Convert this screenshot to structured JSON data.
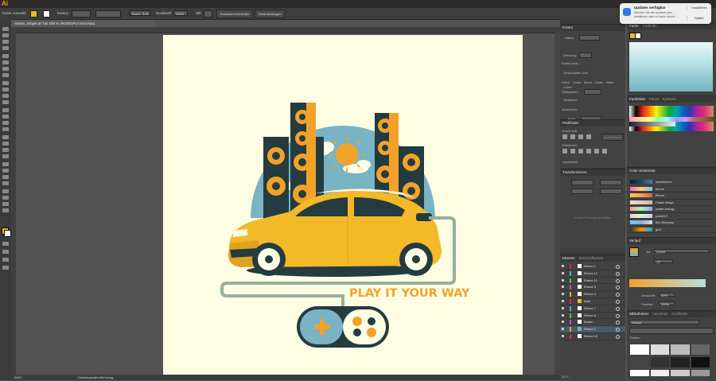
{
  "menubar": {
    "app_logo": "Ai"
  },
  "control_bar": {
    "selection_label": "Keine Auswahl",
    "stroke_label": "Kontur:",
    "stroke_profile": "Rund · 3 Pt.",
    "opacity_label": "Deckkraft:",
    "opacity_value": "100%",
    "style_label": "Stil:",
    "doc_setup_button": "Dokument einrichten",
    "prefs_button": "Voreinstellungen"
  },
  "document": {
    "tab_title": "nissan_simple.ai* bei 150 % (RGB/GPU-Vorschau)",
    "zoom": "150%",
    "status_tool": "Direktauswahl-Werkzeug"
  },
  "artwork": {
    "headline": "PLAY IT YOUR WAY"
  },
  "notification": {
    "title": "Updates verfügbar",
    "body_line1": "Möchten Sie die Updates jetzt",
    "body_line2": "installieren oder es heute Abend ...",
    "install_button": "Installieren",
    "later_button": "Später"
  },
  "panels": {
    "kontur": {
      "title": "Kontur",
      "starke": "Stärke:",
      "gehrung": "Gehrung:",
      "ausrichten": "Kontur ausr.:",
      "dashed": "Gestrichelte Linie",
      "dash_cols": [
        "Strich",
        "Lücke",
        "Strich",
        "Lücke",
        "Strich",
        "Lücke"
      ],
      "pfeilspitzen": "Pfeilspitzen:",
      "skalieren": "Skalieren:",
      "ausrichten2": "Ausrichten:",
      "profil": "Profil:"
    },
    "farbe": {
      "title": "Farbe",
      "tab2": "Farbhilfe"
    },
    "farbfelder": {
      "tabs": [
        "Farbfelder",
        "Pinsel",
        "Symbole"
      ]
    },
    "pathfinder": {
      "title": "Pathfinder",
      "formmodi": "Formmodi:",
      "umwandeln": "Umwandeln",
      "pathfinder_label": "Pathfinder:",
      "tab2": "Ausrichten"
    },
    "transformieren": {
      "title": "Transformieren",
      "empty": "Keine Formeigenschaften"
    },
    "ebenen": {
      "title": "Ebenen",
      "tab2": "Zeichenflächen",
      "layers": [
        "Ebene 1",
        "Ebene 12",
        "Ebene 11",
        "Ebene 5",
        "Ebene 3",
        "Auto",
        "Ebene 7",
        "Ebene 8",
        "Boden",
        "Ebene 2",
        "Ebene 10"
      ],
      "footer": "11 E..."
    },
    "farbschemata": {
      "title": "Color-Schemata",
      "rows": [
        "nachtimmel",
        "blume",
        "Blume",
        "Pastel Beige",
        "pastel energy",
        "pastell 2",
        "Ibiz Bluegray",
        "grid"
      ]
    },
    "verlauf": {
      "title": "Verlauf",
      "art_label": "Art:",
      "art_value": "Linear",
      "angle_value": "-0°",
      "deckkraft_label": "Deckkraft:",
      "deckkraft_value": "50%",
      "position_label": "Position:",
      "position_value": "100%"
    },
    "bibliotheken": {
      "tabs": [
        "Bibliotheken",
        "Aussehen",
        "Grafikstile"
      ],
      "search_value": "Nissan",
      "group": "Farben"
    }
  },
  "colors": {
    "ui_dark": "#535353",
    "artboard": "#fdfde4",
    "accent_orange": "#f2a229",
    "car_yellow": "#f4b928",
    "teal_dark": "#243b3f",
    "sky_blue": "#7ab3c4"
  }
}
